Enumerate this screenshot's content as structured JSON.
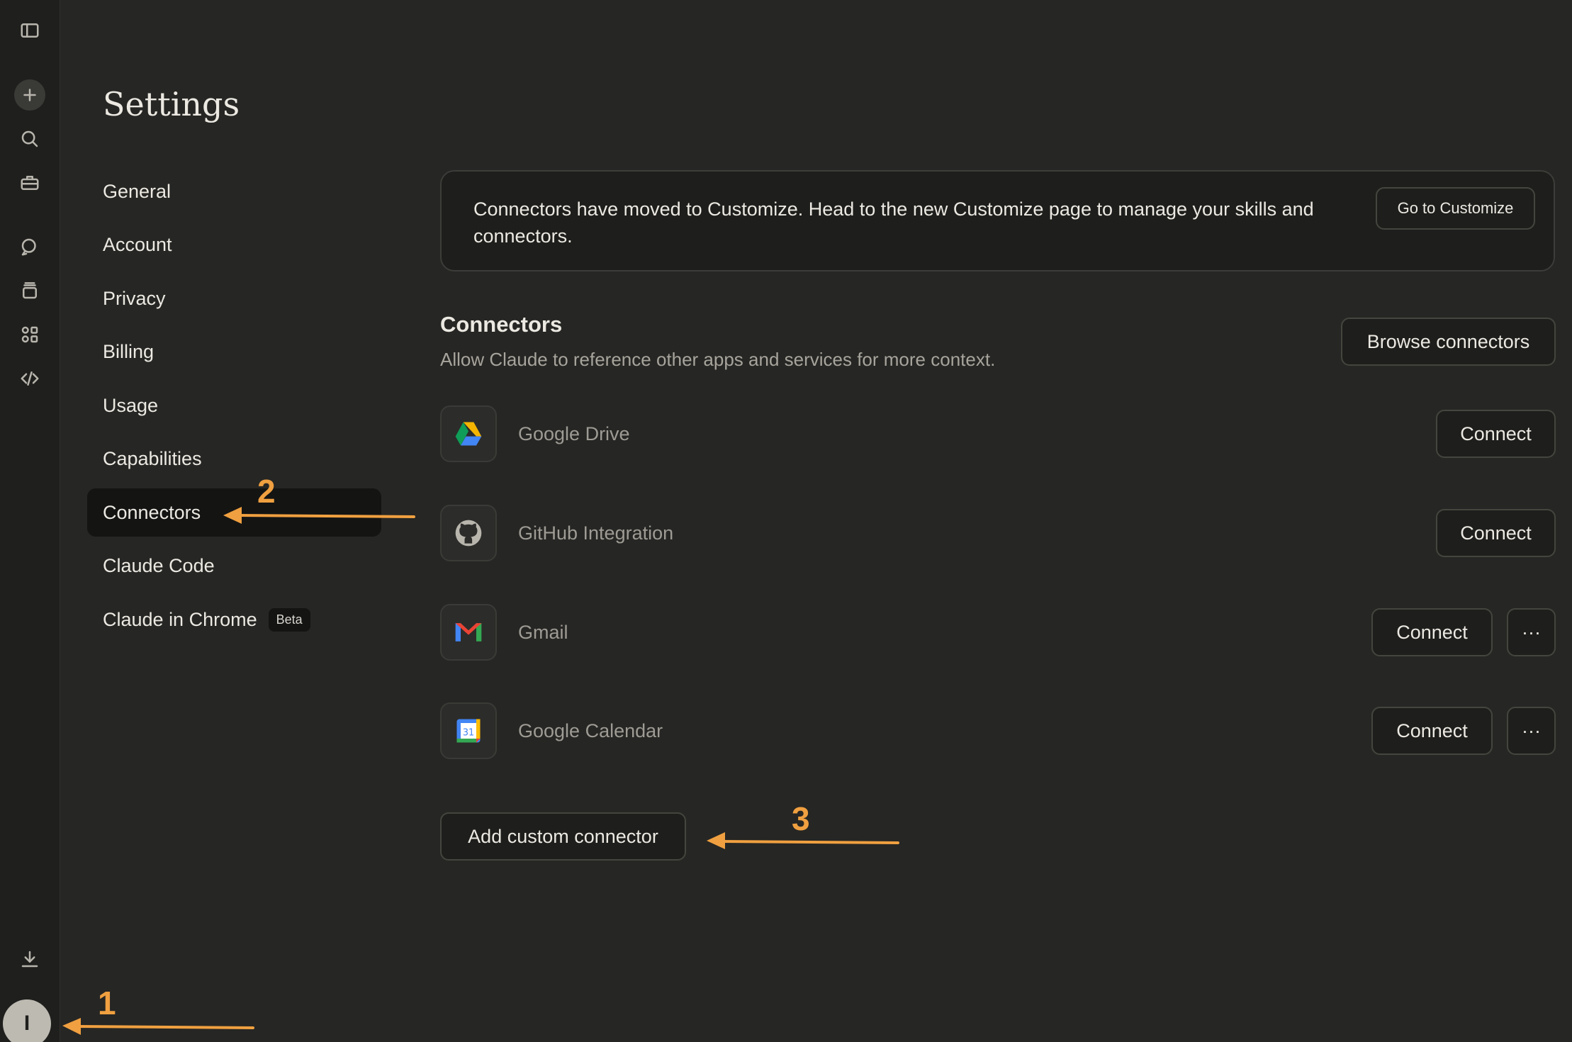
{
  "settings": {
    "title": "Settings",
    "nav": [
      {
        "label": "General"
      },
      {
        "label": "Account"
      },
      {
        "label": "Privacy"
      },
      {
        "label": "Billing"
      },
      {
        "label": "Usage"
      },
      {
        "label": "Capabilities"
      },
      {
        "label": "Connectors",
        "active": true
      },
      {
        "label": "Claude Code"
      },
      {
        "label": "Claude in Chrome",
        "badge": "Beta"
      }
    ]
  },
  "banner": {
    "text": "Connectors have moved to Customize. Head to the new Customize page to manage your skills and connectors.",
    "button": "Go to Customize"
  },
  "connectors": {
    "title": "Connectors",
    "description": "Allow Claude to reference other apps and services for more context.",
    "browse_button": "Browse connectors",
    "items": [
      {
        "name": "Google Drive",
        "action": "Connect",
        "icon": "google-drive-icon"
      },
      {
        "name": "GitHub Integration",
        "action": "Connect",
        "icon": "github-icon"
      },
      {
        "name": "Gmail",
        "action": "Connect",
        "icon": "gmail-icon",
        "more": "···"
      },
      {
        "name": "Google Calendar",
        "action": "Connect",
        "icon": "google-calendar-icon",
        "more": "···",
        "day": "31"
      }
    ],
    "add_custom": "Add custom connector"
  },
  "user": {
    "initial": "I"
  },
  "annotations": [
    "1",
    "2",
    "3"
  ],
  "colors": {
    "background": "#262624",
    "rail": "#1f1f1d",
    "accent_annotation": "#f0a040"
  }
}
